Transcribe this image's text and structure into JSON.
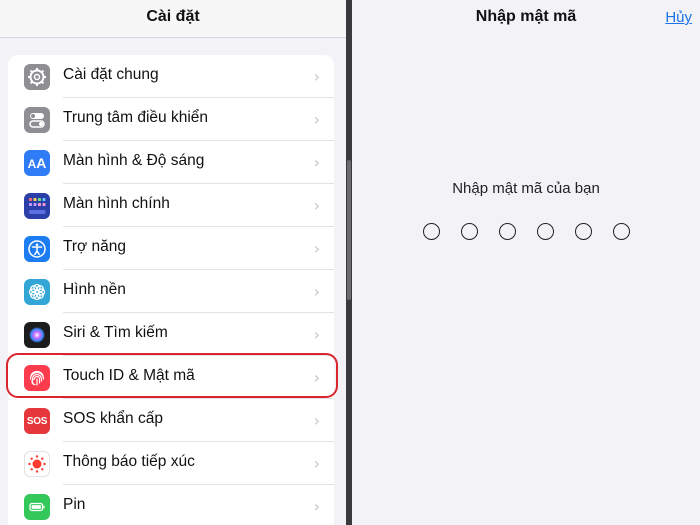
{
  "left": {
    "title": "Cài đặt",
    "items": [
      {
        "label": "Cài đặt chung",
        "icon": "gear-icon",
        "color": "#8e8e93"
      },
      {
        "label": "Trung tâm điều khiển",
        "icon": "toggles-icon",
        "color": "#8e8e93"
      },
      {
        "label": "Màn hình & Độ sáng",
        "icon": "text-size-icon",
        "color": "#2f7cf6"
      },
      {
        "label": "Màn hình chính",
        "icon": "home-grid-icon",
        "color": "#2c3ea8"
      },
      {
        "label": "Trợ năng",
        "icon": "accessibility-icon",
        "color": "#1c7cf2"
      },
      {
        "label": "Hình nền",
        "icon": "flower-icon",
        "color": "#33a6d6"
      },
      {
        "label": "Siri & Tìm kiếm",
        "icon": "siri-icon",
        "color": "#1c1c1e"
      },
      {
        "label": "Touch ID & Mật mã",
        "icon": "fingerprint-icon",
        "color": "#ff3b4e"
      },
      {
        "label": "SOS khẩn cấp",
        "icon": "sos-icon",
        "color": "#e5373c"
      },
      {
        "label": "Thông báo tiếp xúc",
        "icon": "exposure-icon",
        "color": "#ffffff"
      },
      {
        "label": "Pin",
        "icon": "battery-icon",
        "color": "#34c759"
      }
    ],
    "sos_text": "SOS"
  },
  "right": {
    "title": "Nhập mật mã",
    "cancel_label": "Hủy",
    "prompt": "Nhập mật mã của bạn",
    "passcode_length": 6
  },
  "colors": {
    "highlight": "#d9262c",
    "link": "#1a73e8"
  }
}
